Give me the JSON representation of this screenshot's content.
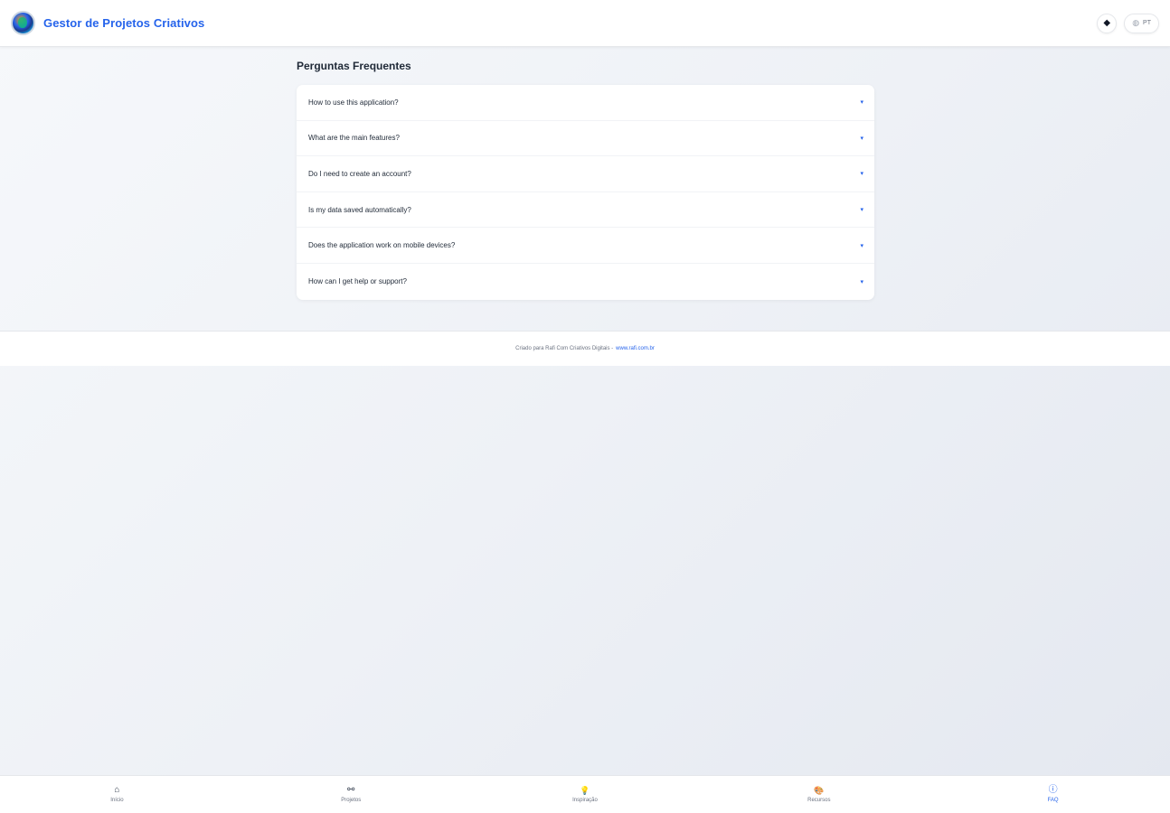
{
  "header": {
    "title": "Gestor de Projetos Criativos",
    "theme_icon": "palette-icon",
    "language_label": "PT"
  },
  "faq": {
    "title": "Perguntas Frequentes",
    "items": [
      {
        "question": "How to use this application?"
      },
      {
        "question": "What are the main features?"
      },
      {
        "question": "Do I need to create an account?"
      },
      {
        "question": "Is my data saved automatically?"
      },
      {
        "question": "Does the application work on mobile devices?"
      },
      {
        "question": "How can I get help or support?"
      }
    ],
    "chevron": "▾"
  },
  "footer": {
    "text": "Criado para Rafi Com Criativos Digitais -",
    "link_text": "www.rafi.com.br"
  },
  "bottom_nav": {
    "items": [
      {
        "label": "Início",
        "icon": "⌂"
      },
      {
        "label": "Projetos",
        "icon": "⚯"
      },
      {
        "label": "Inspiração",
        "icon": "💡"
      },
      {
        "label": "Recursos",
        "icon": "🎨"
      },
      {
        "label": "FAQ",
        "icon": "ⓘ"
      }
    ],
    "active": "FAQ"
  },
  "colors": {
    "accent": "#2563eb",
    "text": "#1f2937",
    "muted": "#6b7280"
  }
}
